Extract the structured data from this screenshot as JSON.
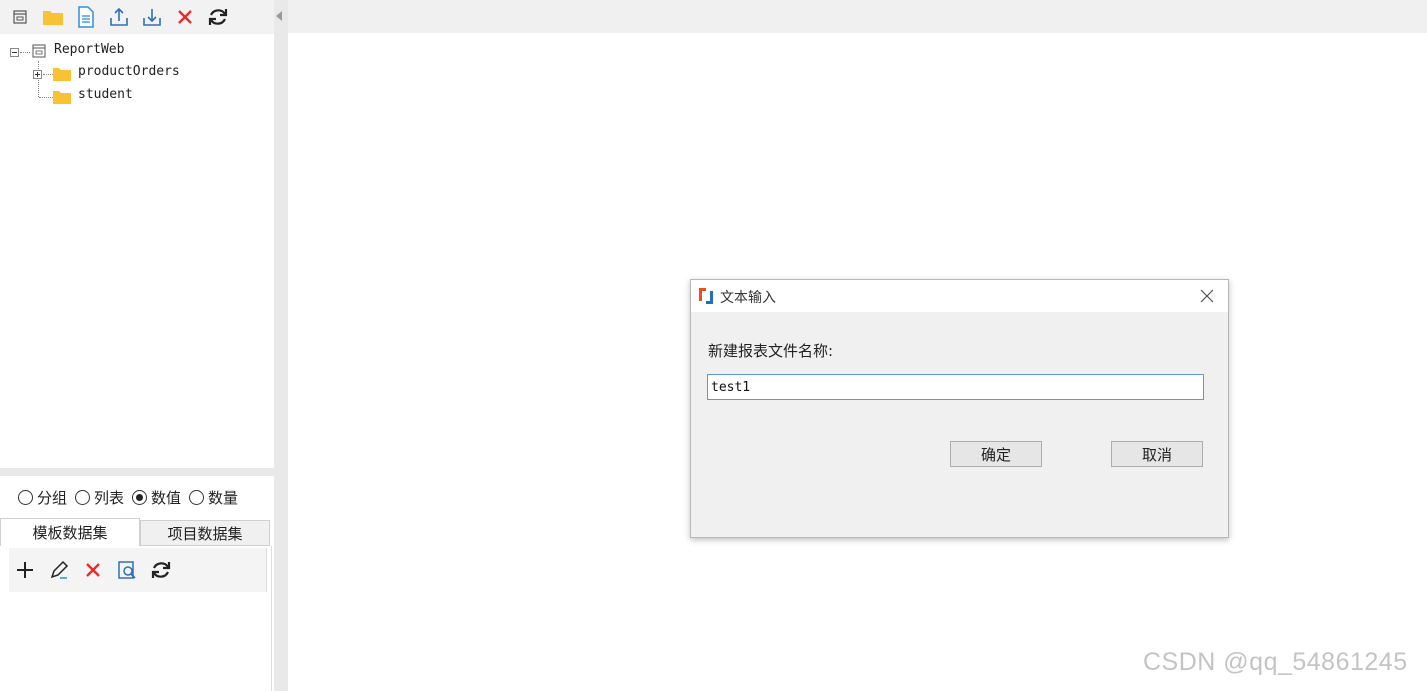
{
  "toolbar": {
    "icons": [
      "window-icon",
      "folder-icon",
      "file-icon",
      "upload-icon",
      "download-icon",
      "delete-icon",
      "refresh-icon"
    ]
  },
  "tree": {
    "root": "ReportWeb",
    "children": [
      {
        "label": "productOrders",
        "expandable": true
      },
      {
        "label": "student",
        "expandable": false
      }
    ]
  },
  "radios": {
    "options": [
      "分组",
      "列表",
      "数值",
      "数量"
    ],
    "selected": "数值"
  },
  "tabs": {
    "active": "模板数据集",
    "inactive": "项目数据集"
  },
  "dialog": {
    "title": "文本输入",
    "label": "新建报表文件名称:",
    "input_value": "test1",
    "ok_label": "确定",
    "cancel_label": "取消"
  },
  "watermark": "CSDN @qq_54861245",
  "colors": {
    "folder": "#f7c234",
    "file_blue": "#2f8fdd",
    "delete_red": "#e52b2b",
    "input_border": "#5b9bd5"
  }
}
